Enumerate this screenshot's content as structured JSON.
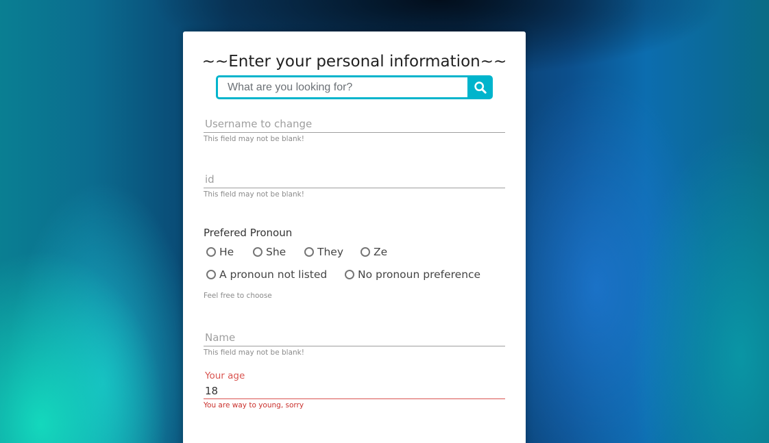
{
  "form": {
    "title": "~~Enter your personal information~~",
    "search": {
      "placeholder": "What are you looking for?",
      "button_icon": "search-icon",
      "accent_color": "#00b4cc"
    },
    "username": {
      "placeholder": "Username to change",
      "helper": "This field may not be blank!"
    },
    "id": {
      "placeholder": "id",
      "helper": "This field may not be blank!"
    },
    "pronoun": {
      "label": "Prefered Pronoun",
      "options": [
        "He",
        "She",
        "They",
        "Ze",
        "A pronoun not listed",
        "No pronoun preference"
      ],
      "helper": "Feel free to choose"
    },
    "name": {
      "placeholder": "Name",
      "helper": "This field may not be blank!"
    },
    "age": {
      "label": "Your age",
      "value": "18",
      "error": "You are way to young, sorry",
      "error_color": "#d9534f"
    }
  }
}
